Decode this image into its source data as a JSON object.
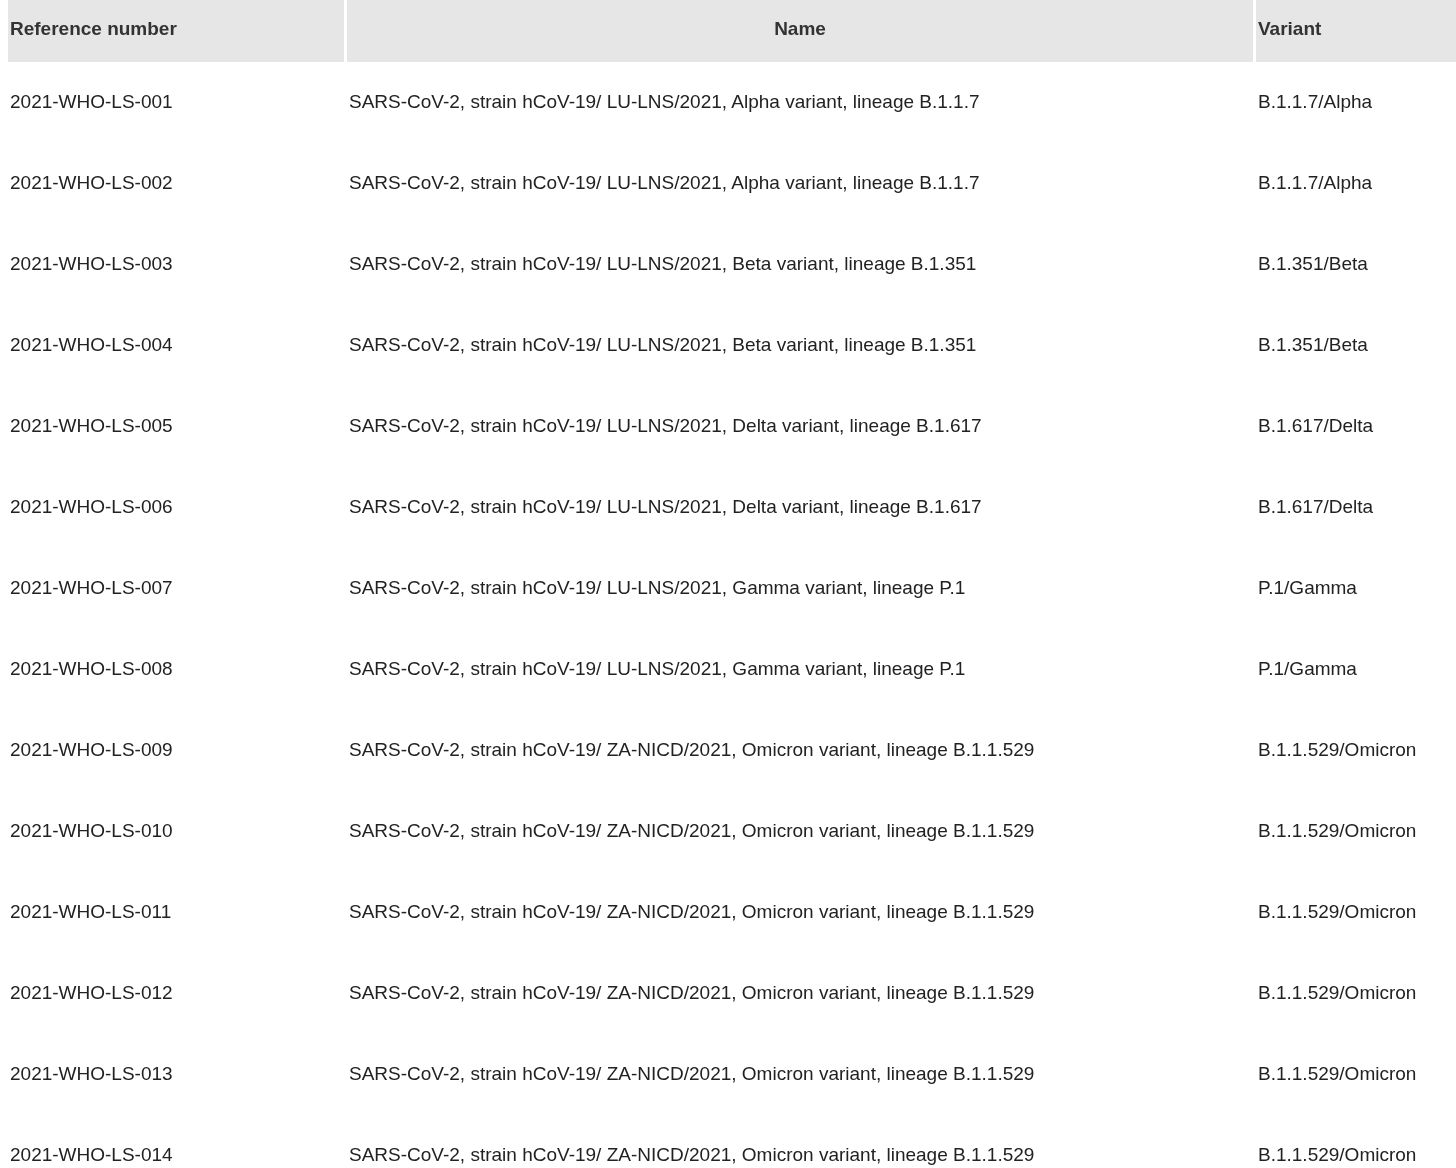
{
  "table": {
    "columns": [
      "Reference number",
      "Name",
      "Variant"
    ],
    "rows": [
      [
        "2021-WHO-LS-001",
        "SARS-CoV-2, strain hCoV-19/ LU-LNS/2021, Alpha variant, lineage B.1.1.7",
        "B.1.1.7/Alpha"
      ],
      [
        "2021-WHO-LS-002",
        "SARS-CoV-2, strain hCoV-19/ LU-LNS/2021, Alpha variant, lineage B.1.1.7",
        "B.1.1.7/Alpha"
      ],
      [
        "2021-WHO-LS-003",
        "SARS-CoV-2, strain hCoV-19/ LU-LNS/2021, Beta variant, lineage B.1.351",
        "B.1.351/Beta"
      ],
      [
        "2021-WHO-LS-004",
        "SARS-CoV-2, strain hCoV-19/ LU-LNS/2021, Beta variant, lineage B.1.351",
        "B.1.351/Beta"
      ],
      [
        "2021-WHO-LS-005",
        "SARS-CoV-2, strain hCoV-19/ LU-LNS/2021, Delta variant, lineage B.1.617",
        "B.1.617/Delta"
      ],
      [
        "2021-WHO-LS-006",
        "SARS-CoV-2, strain hCoV-19/ LU-LNS/2021, Delta variant, lineage B.1.617",
        "B.1.617/Delta"
      ],
      [
        "2021-WHO-LS-007",
        "SARS-CoV-2, strain hCoV-19/ LU-LNS/2021, Gamma variant, lineage P.1",
        "P.1/Gamma"
      ],
      [
        "2021-WHO-LS-008",
        "SARS-CoV-2, strain hCoV-19/ LU-LNS/2021, Gamma variant, lineage P.1",
        "P.1/Gamma"
      ],
      [
        "2021-WHO-LS-009",
        "SARS-CoV-2, strain hCoV-19/ ZA-NICD/2021, Omicron variant, lineage B.1.1.529",
        "B.1.1.529/Omicron"
      ],
      [
        "2021-WHO-LS-010",
        "SARS-CoV-2, strain hCoV-19/ ZA-NICD/2021, Omicron variant, lineage B.1.1.529",
        "B.1.1.529/Omicron"
      ],
      [
        "2021-WHO-LS-011",
        "SARS-CoV-2, strain hCoV-19/ ZA-NICD/2021, Omicron variant, lineage B.1.1.529",
        "B.1.1.529/Omicron"
      ],
      [
        "2021-WHO-LS-012",
        "SARS-CoV-2, strain hCoV-19/ ZA-NICD/2021, Omicron variant, lineage B.1.1.529",
        "B.1.1.529/Omicron"
      ],
      [
        "2021-WHO-LS-013",
        "SARS-CoV-2, strain hCoV-19/ ZA-NICD/2021, Omicron variant, lineage B.1.1.529",
        "B.1.1.529/Omicron"
      ],
      [
        "2021-WHO-LS-014",
        "SARS-CoV-2, strain hCoV-19/ ZA-NICD/2021, Omicron variant, lineage B.1.1.529",
        "B.1.1.529/Omicron"
      ]
    ]
  }
}
